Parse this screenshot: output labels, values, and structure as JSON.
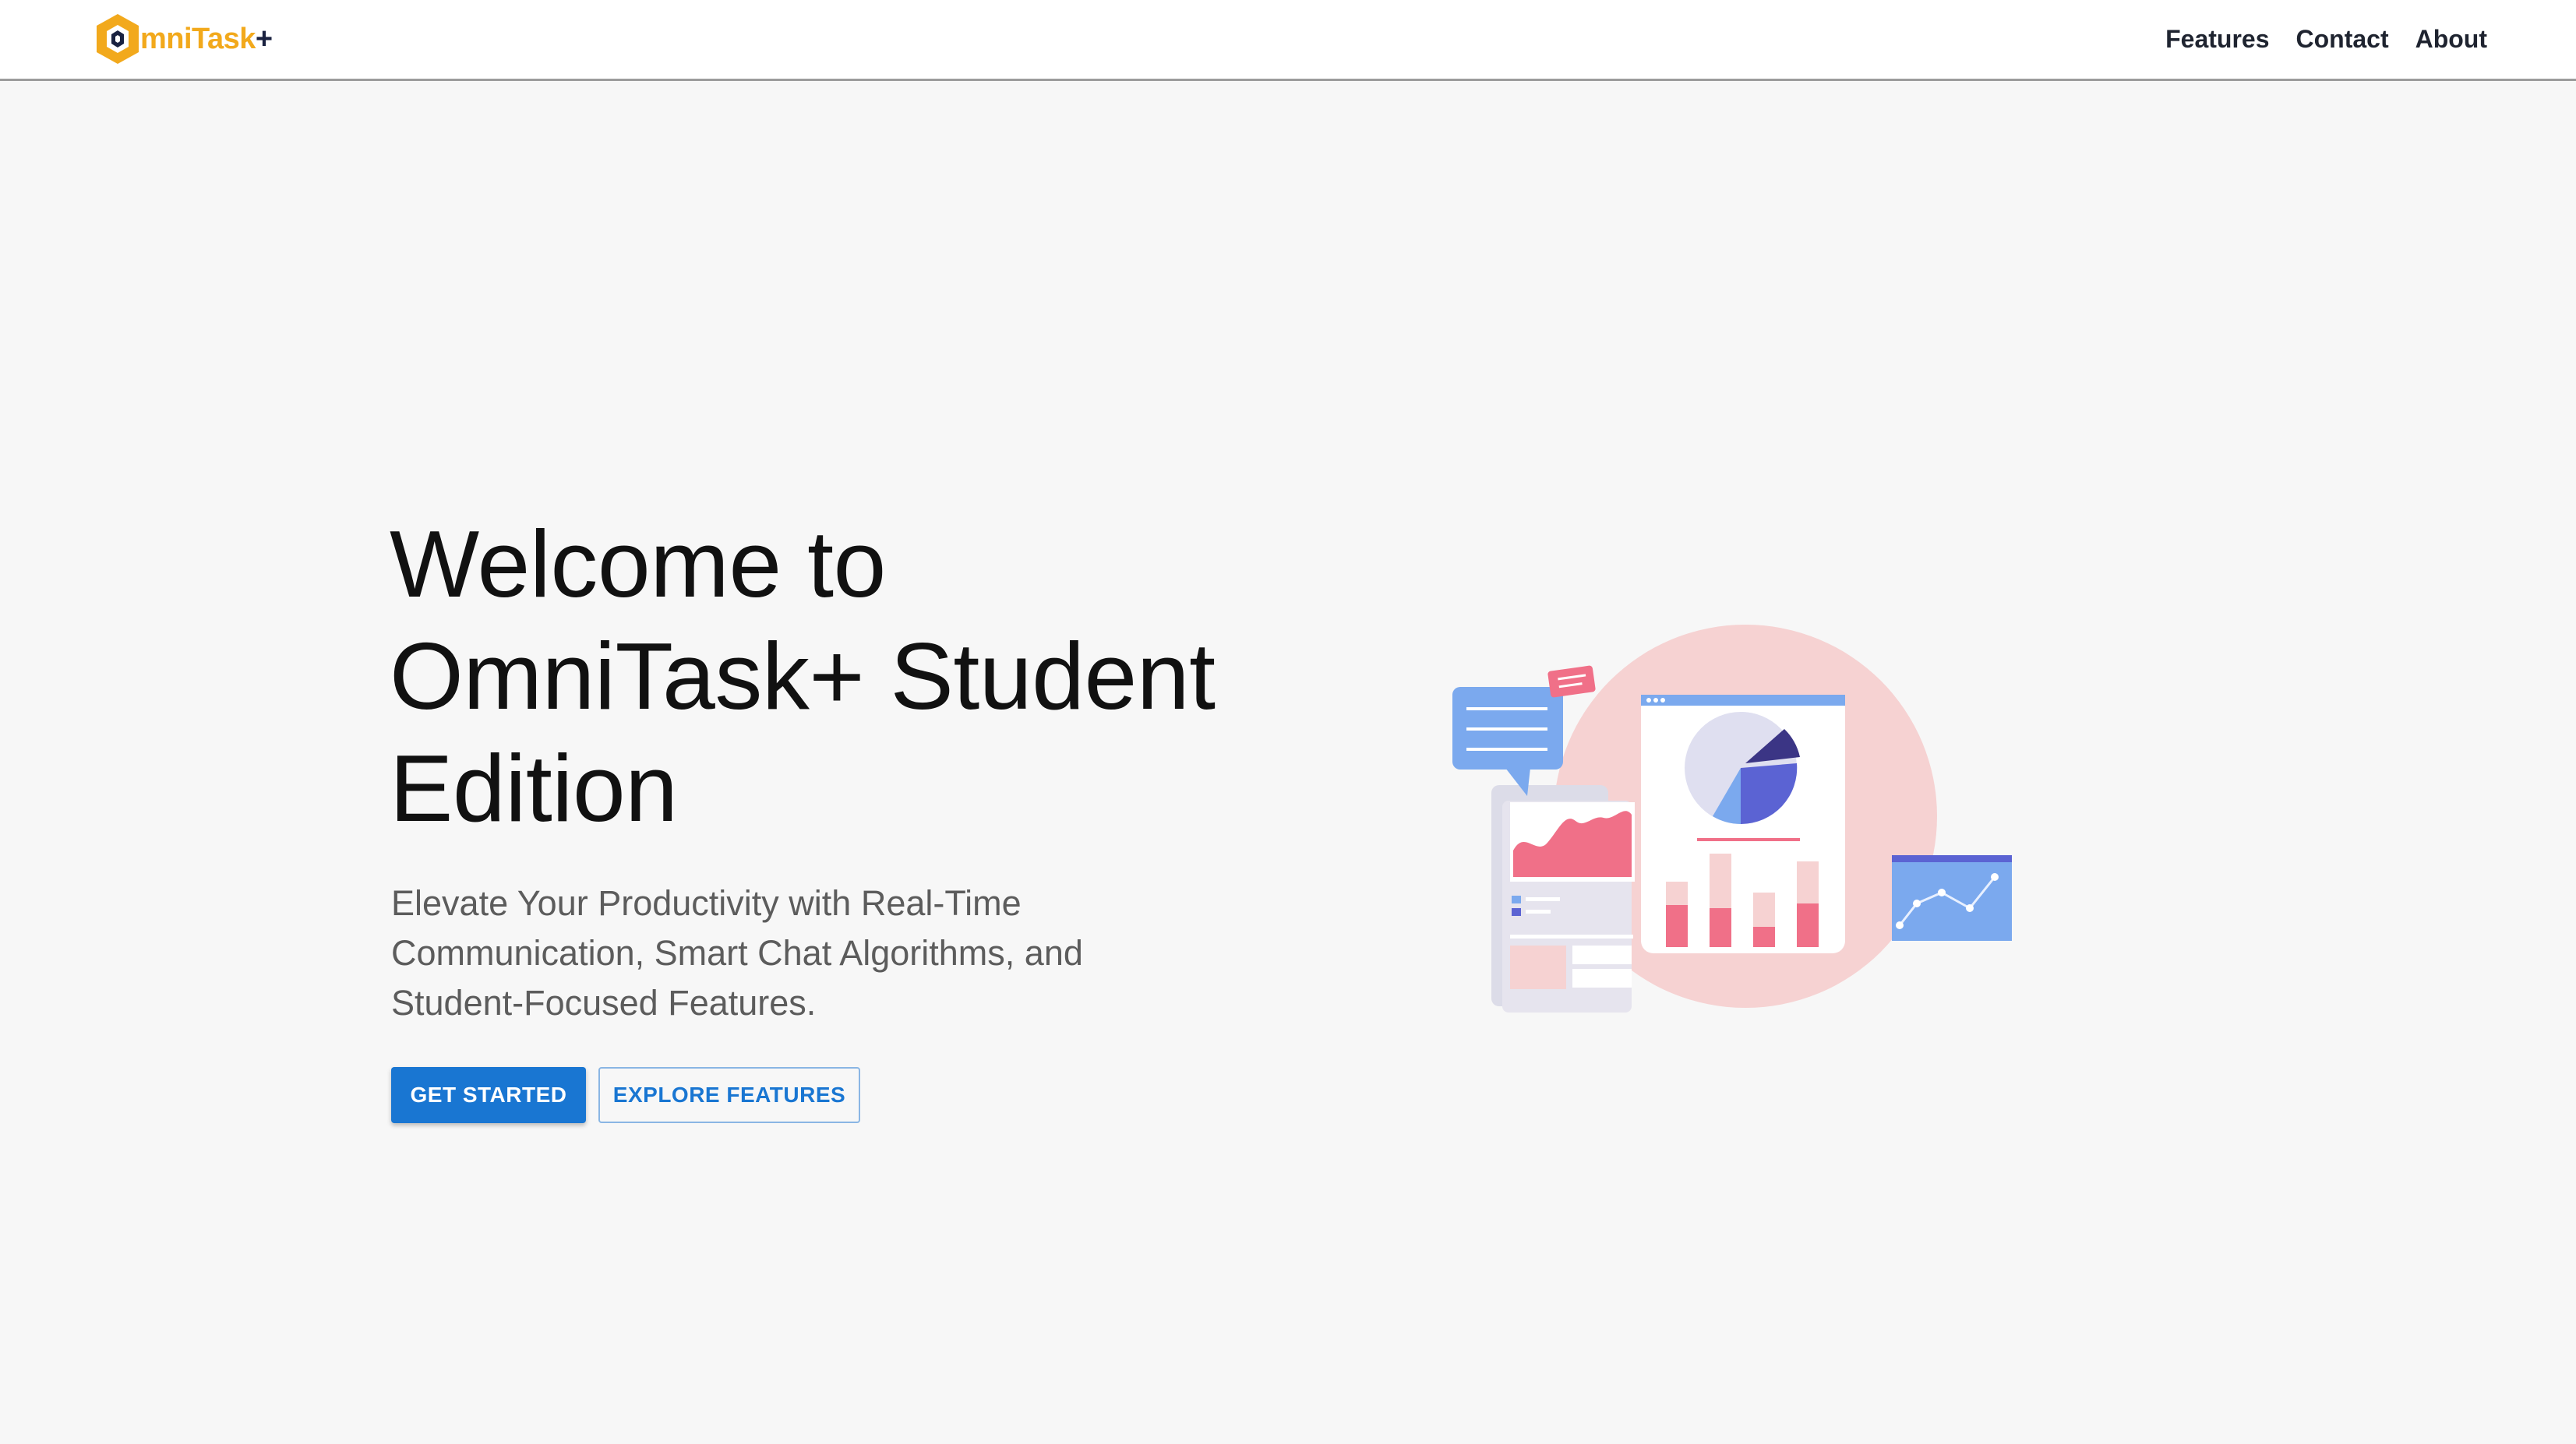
{
  "header": {
    "logo": {
      "icon": "hexagon-logo-icon",
      "text_part1": "mniTask",
      "text_part2": "+",
      "colors": {
        "orange": "#f2a91c",
        "navy": "#1a2240"
      }
    },
    "nav": [
      {
        "label": "Features"
      },
      {
        "label": "Contact"
      },
      {
        "label": "About"
      }
    ]
  },
  "hero": {
    "title_lines": [
      "Welcome to",
      "OmniTask+ Student",
      "Edition"
    ],
    "subtitle_lines": [
      "Elevate Your Productivity with Real-Time",
      "Communication, Smart Chat Algorithms, and",
      "Student-Focused Features."
    ],
    "primary_button": "GET STARTED",
    "secondary_button": "EXPLORE FEATURES",
    "accent_color": "#1976d2"
  },
  "illustration": {
    "icon": "analytics-dashboard-illustration",
    "colors": {
      "pink": "#f07088",
      "blush": "#f6d2d2",
      "blue": "#7ba9ee",
      "indigo": "#5b63d3",
      "navy": "#3b3585"
    }
  }
}
